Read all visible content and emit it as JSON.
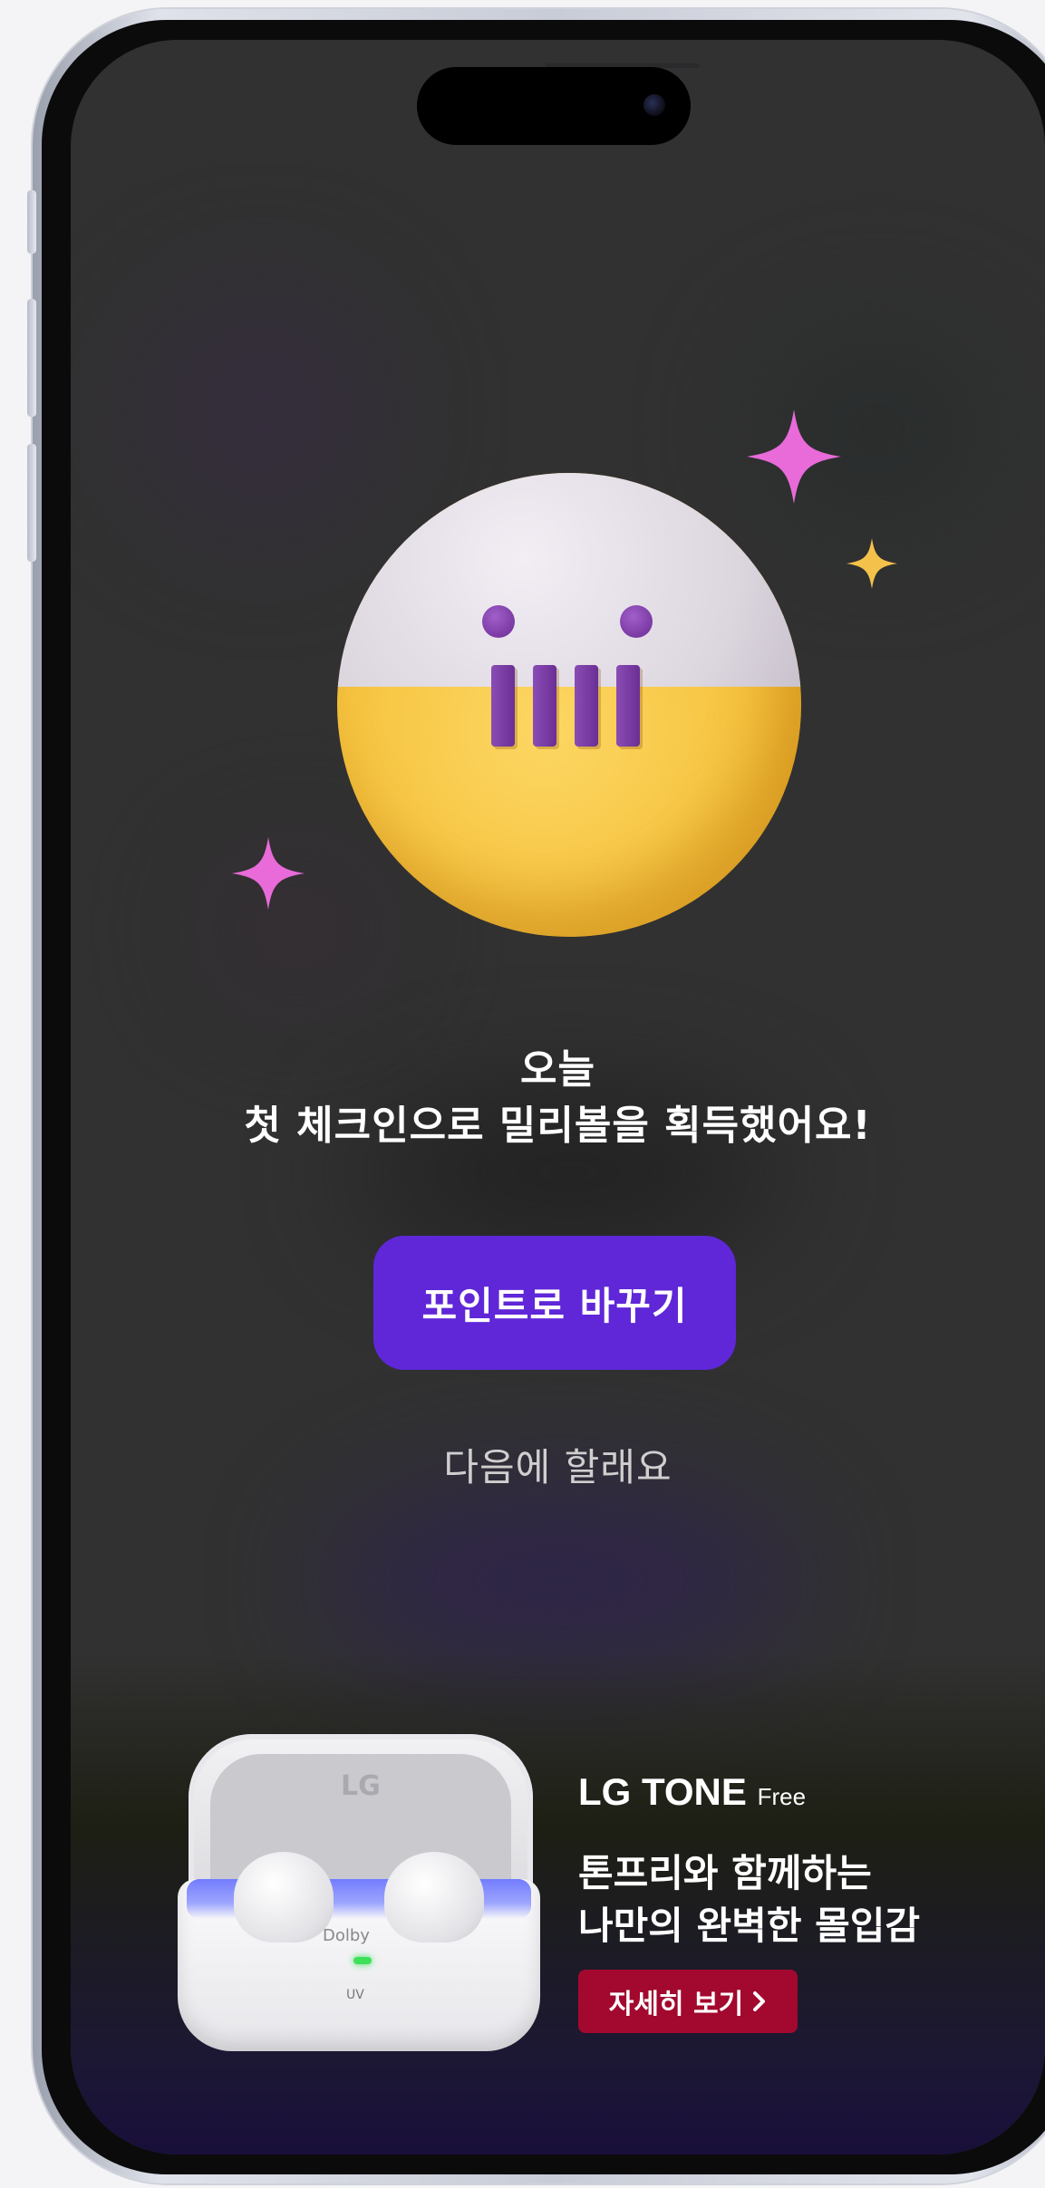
{
  "reward": {
    "title_line1": "오늘",
    "title_line2": "첫 체크인으로 밀리볼을 획득했어요!",
    "convert_button_label": "포인트로 바꾸기",
    "later_link_label": "다음에 할래요"
  },
  "ad": {
    "brand": "LG TONE",
    "brand_suffix": "Free",
    "headline_line1": "톤프리와 함께하는",
    "headline_line2": "나만의 완벽한 몰입감",
    "cta_label": "자세히 보기",
    "product_logo": "LG",
    "product_badge": "Dolby",
    "product_uv_label": "UV"
  },
  "colors": {
    "primary_button": "#5f27d8",
    "ad_cta": "#a3082e",
    "ball_yellow": "#f6c23c",
    "ball_purple": "#7a3aa3",
    "sparkle_pink": "#e86bd9",
    "sparkle_yellow": "#f4c24a",
    "screen_background": "#313131"
  },
  "icons": {
    "mascot": "milli-ball-icon",
    "sparkle_large": "sparkle-pink-icon",
    "sparkle_small": "sparkle-yellow-icon",
    "cta_chevron": "chevron-right-icon"
  }
}
